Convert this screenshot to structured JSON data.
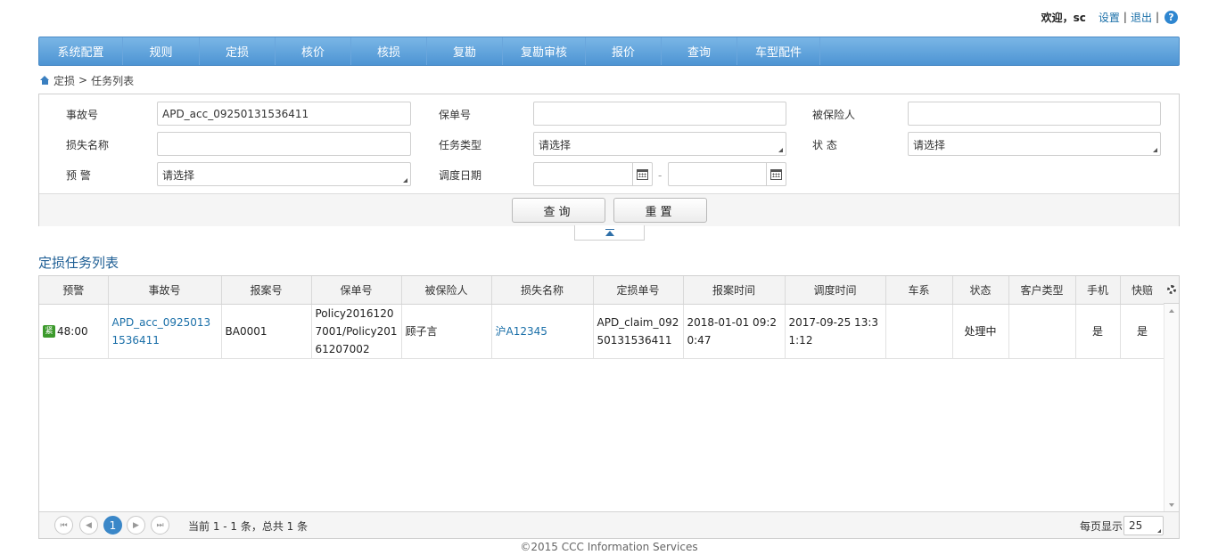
{
  "topbar": {
    "welcome": "欢迎，sc",
    "settings": "设置",
    "logout": "退出",
    "help": "?"
  },
  "nav": [
    "系统配置",
    "规则",
    "定损",
    "核价",
    "核损",
    "复勘",
    "复勘审核",
    "报价",
    "查询",
    "车型配件"
  ],
  "breadcrumb": {
    "root": "定损",
    "sep": ">",
    "current": "任务列表"
  },
  "search": {
    "accident_no_label": "事故号",
    "accident_no_value": "APD_acc_09250131536411",
    "policy_no_label": "保单号",
    "policy_no_value": "",
    "insured_label": "被保险人",
    "insured_value": "",
    "loss_name_label": "损失名称",
    "loss_name_value": "",
    "task_type_label": "任务类型",
    "task_type_value": "请选择",
    "status_label": "状 态",
    "status_value": "请选择",
    "warning_label": "预 警",
    "warning_value": "请选择",
    "dispatch_date_label": "调度日期",
    "date_from": "",
    "date_to": "",
    "date_sep": "-",
    "query_btn": "查询",
    "reset_btn": "重置"
  },
  "list_title": "定损任务列表",
  "table": {
    "headers": [
      "预警",
      "事故号",
      "报案号",
      "保单号",
      "被保险人",
      "损失名称",
      "定损单号",
      "报案时间",
      "调度时间",
      "车系",
      "状态",
      "客户类型",
      "手机",
      "快赔"
    ],
    "rows": [
      {
        "warn_badge": "紧",
        "warn_time": "48:00",
        "accident_no": "APD_acc_09250131536411",
        "report_no": "BA0001",
        "policy_no": "Policy20161207001/Policy20161207002",
        "insured": "顾子言",
        "loss_name": "沪A12345",
        "claim_no": "APD_claim_09250131536411",
        "report_time": "2018-01-01 09:20:47",
        "dispatch_time": "2017-09-25 13:31:12",
        "series": "",
        "status": "处理中",
        "customer_type": "",
        "mobile": "是",
        "quick_pay": "是"
      }
    ]
  },
  "pager": {
    "current_page": "1",
    "info": "当前 1 - 1 条，总共 1 条",
    "page_size_label": "每页显示",
    "page_size": "25"
  },
  "footer": "©2015 CCC Information Services",
  "colors": {
    "nav_top": "#7ab6e6",
    "nav_bottom": "#4d94d3",
    "link": "#1a6fa8",
    "title": "#1f5f95",
    "badge": "#3c9a2c"
  }
}
